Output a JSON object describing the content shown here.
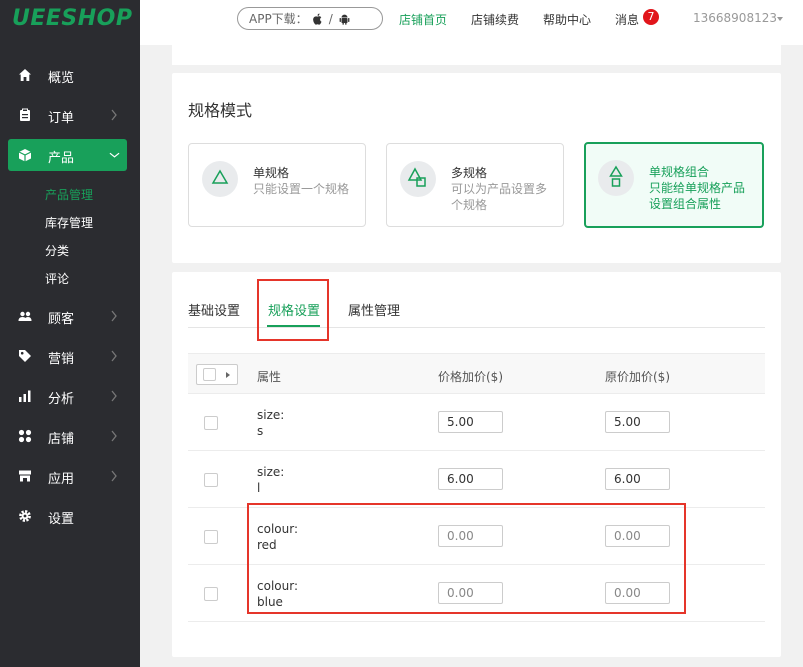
{
  "brand": {
    "logo": "UEESHOP"
  },
  "topbar": {
    "app_label": "APP下载：",
    "app_sep": "/",
    "links": [
      "店铺首页",
      "店铺续费",
      "帮助中心",
      "消息"
    ],
    "message_count": "7",
    "user": "13668908123"
  },
  "sidebar": {
    "items": [
      {
        "label": "概览",
        "icon": "home-icon"
      },
      {
        "label": "订单",
        "icon": "clipboard-icon"
      },
      {
        "label": "产品",
        "icon": "box-icon"
      },
      {
        "label": "顾客",
        "icon": "users-icon"
      },
      {
        "label": "营销",
        "icon": "tag-icon"
      },
      {
        "label": "分析",
        "icon": "bar-chart-icon"
      },
      {
        "label": "店铺",
        "icon": "grid-icon"
      },
      {
        "label": "应用",
        "icon": "store-icon"
      },
      {
        "label": "设置",
        "icon": "gear-icon"
      }
    ],
    "sub_items": [
      "产品管理",
      "库存管理",
      "分类",
      "评论"
    ]
  },
  "spec_mode": {
    "title": "规格模式",
    "options": [
      {
        "title": "单规格",
        "desc": "只能设置一个规格"
      },
      {
        "title": "多规格",
        "desc": "可以为产品设置多个规格"
      },
      {
        "title": "单规格组合",
        "desc": "只能给单规格产品设置组合属性"
      }
    ]
  },
  "tabs": [
    "基础设置",
    "规格设置",
    "属性管理"
  ],
  "table": {
    "headers": [
      "属性",
      "价格加价($)",
      "原价加价($)"
    ],
    "rows": [
      {
        "attr_name": "size:",
        "attr_value": "s",
        "price": "5.00",
        "original": "5.00"
      },
      {
        "attr_name": "size:",
        "attr_value": "l",
        "price": "6.00",
        "original": "6.00"
      },
      {
        "attr_name": "colour:",
        "attr_value": "red",
        "price_placeholder": "0.00",
        "original_placeholder": "0.00"
      },
      {
        "attr_name": "colour:",
        "attr_value": "blue",
        "price_placeholder": "0.00",
        "original_placeholder": "0.00"
      }
    ]
  },
  "colors": {
    "accent": "#18a05a",
    "sidebar": "#2b2c30",
    "highlight": "#e5352a",
    "badge": "#e1151b"
  }
}
